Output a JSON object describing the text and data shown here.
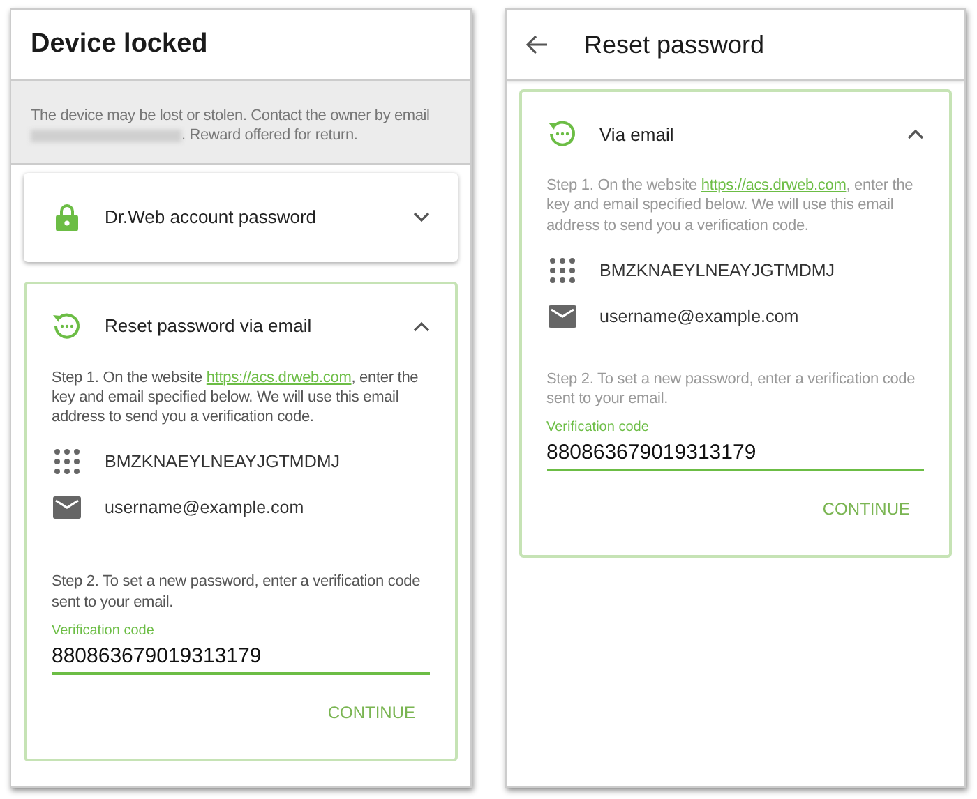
{
  "screens": [
    {
      "header": {
        "title": "Device locked",
        "back_button": false
      },
      "notice": {
        "line_1": "The device may be lost or stolen. Contact the owner by email",
        "line_2": ". Reward offered for return."
      },
      "sections": [
        {
          "kind": "password",
          "title": "Dr.Web account password",
          "expanded": false
        },
        {
          "kind": "email",
          "title": "Reset password via email",
          "expanded": true,
          "dimmed": false,
          "step_1": {
            "before": "Step 1. On the website ",
            "link": "https://acs.drweb.com",
            "after": ", enter the key and email specified below. We will use this email address to send you a verification code."
          },
          "key": "BMZKNAEYLNEAYJGTMDMJ",
          "email": "username@example.com",
          "step_2": "Step 2. To set a new password, enter a verification code sent to your email.",
          "field": {
            "label": "Verification code",
            "value": "880863679019313179"
          },
          "button": "CONTINUE"
        }
      ]
    },
    {
      "header": {
        "title": "Reset password",
        "back_button": true
      },
      "sections": [
        {
          "kind": "email",
          "title": "Via email",
          "expanded": true,
          "dimmed": true,
          "step_1": {
            "before": "Step 1. On the website ",
            "link": "https://acs.drweb.com",
            "after": ", enter the key and email specified below. We will use this email address to send you a verification code."
          },
          "key": "BMZKNAEYLNEAYJGTMDMJ",
          "email": "username@example.com",
          "step_2": "Step 2. To set a new password, enter a verification code sent to your email.",
          "field": {
            "label": "Verification code",
            "value": "880863679019313179"
          },
          "button": "CONTINUE"
        }
      ]
    }
  ]
}
